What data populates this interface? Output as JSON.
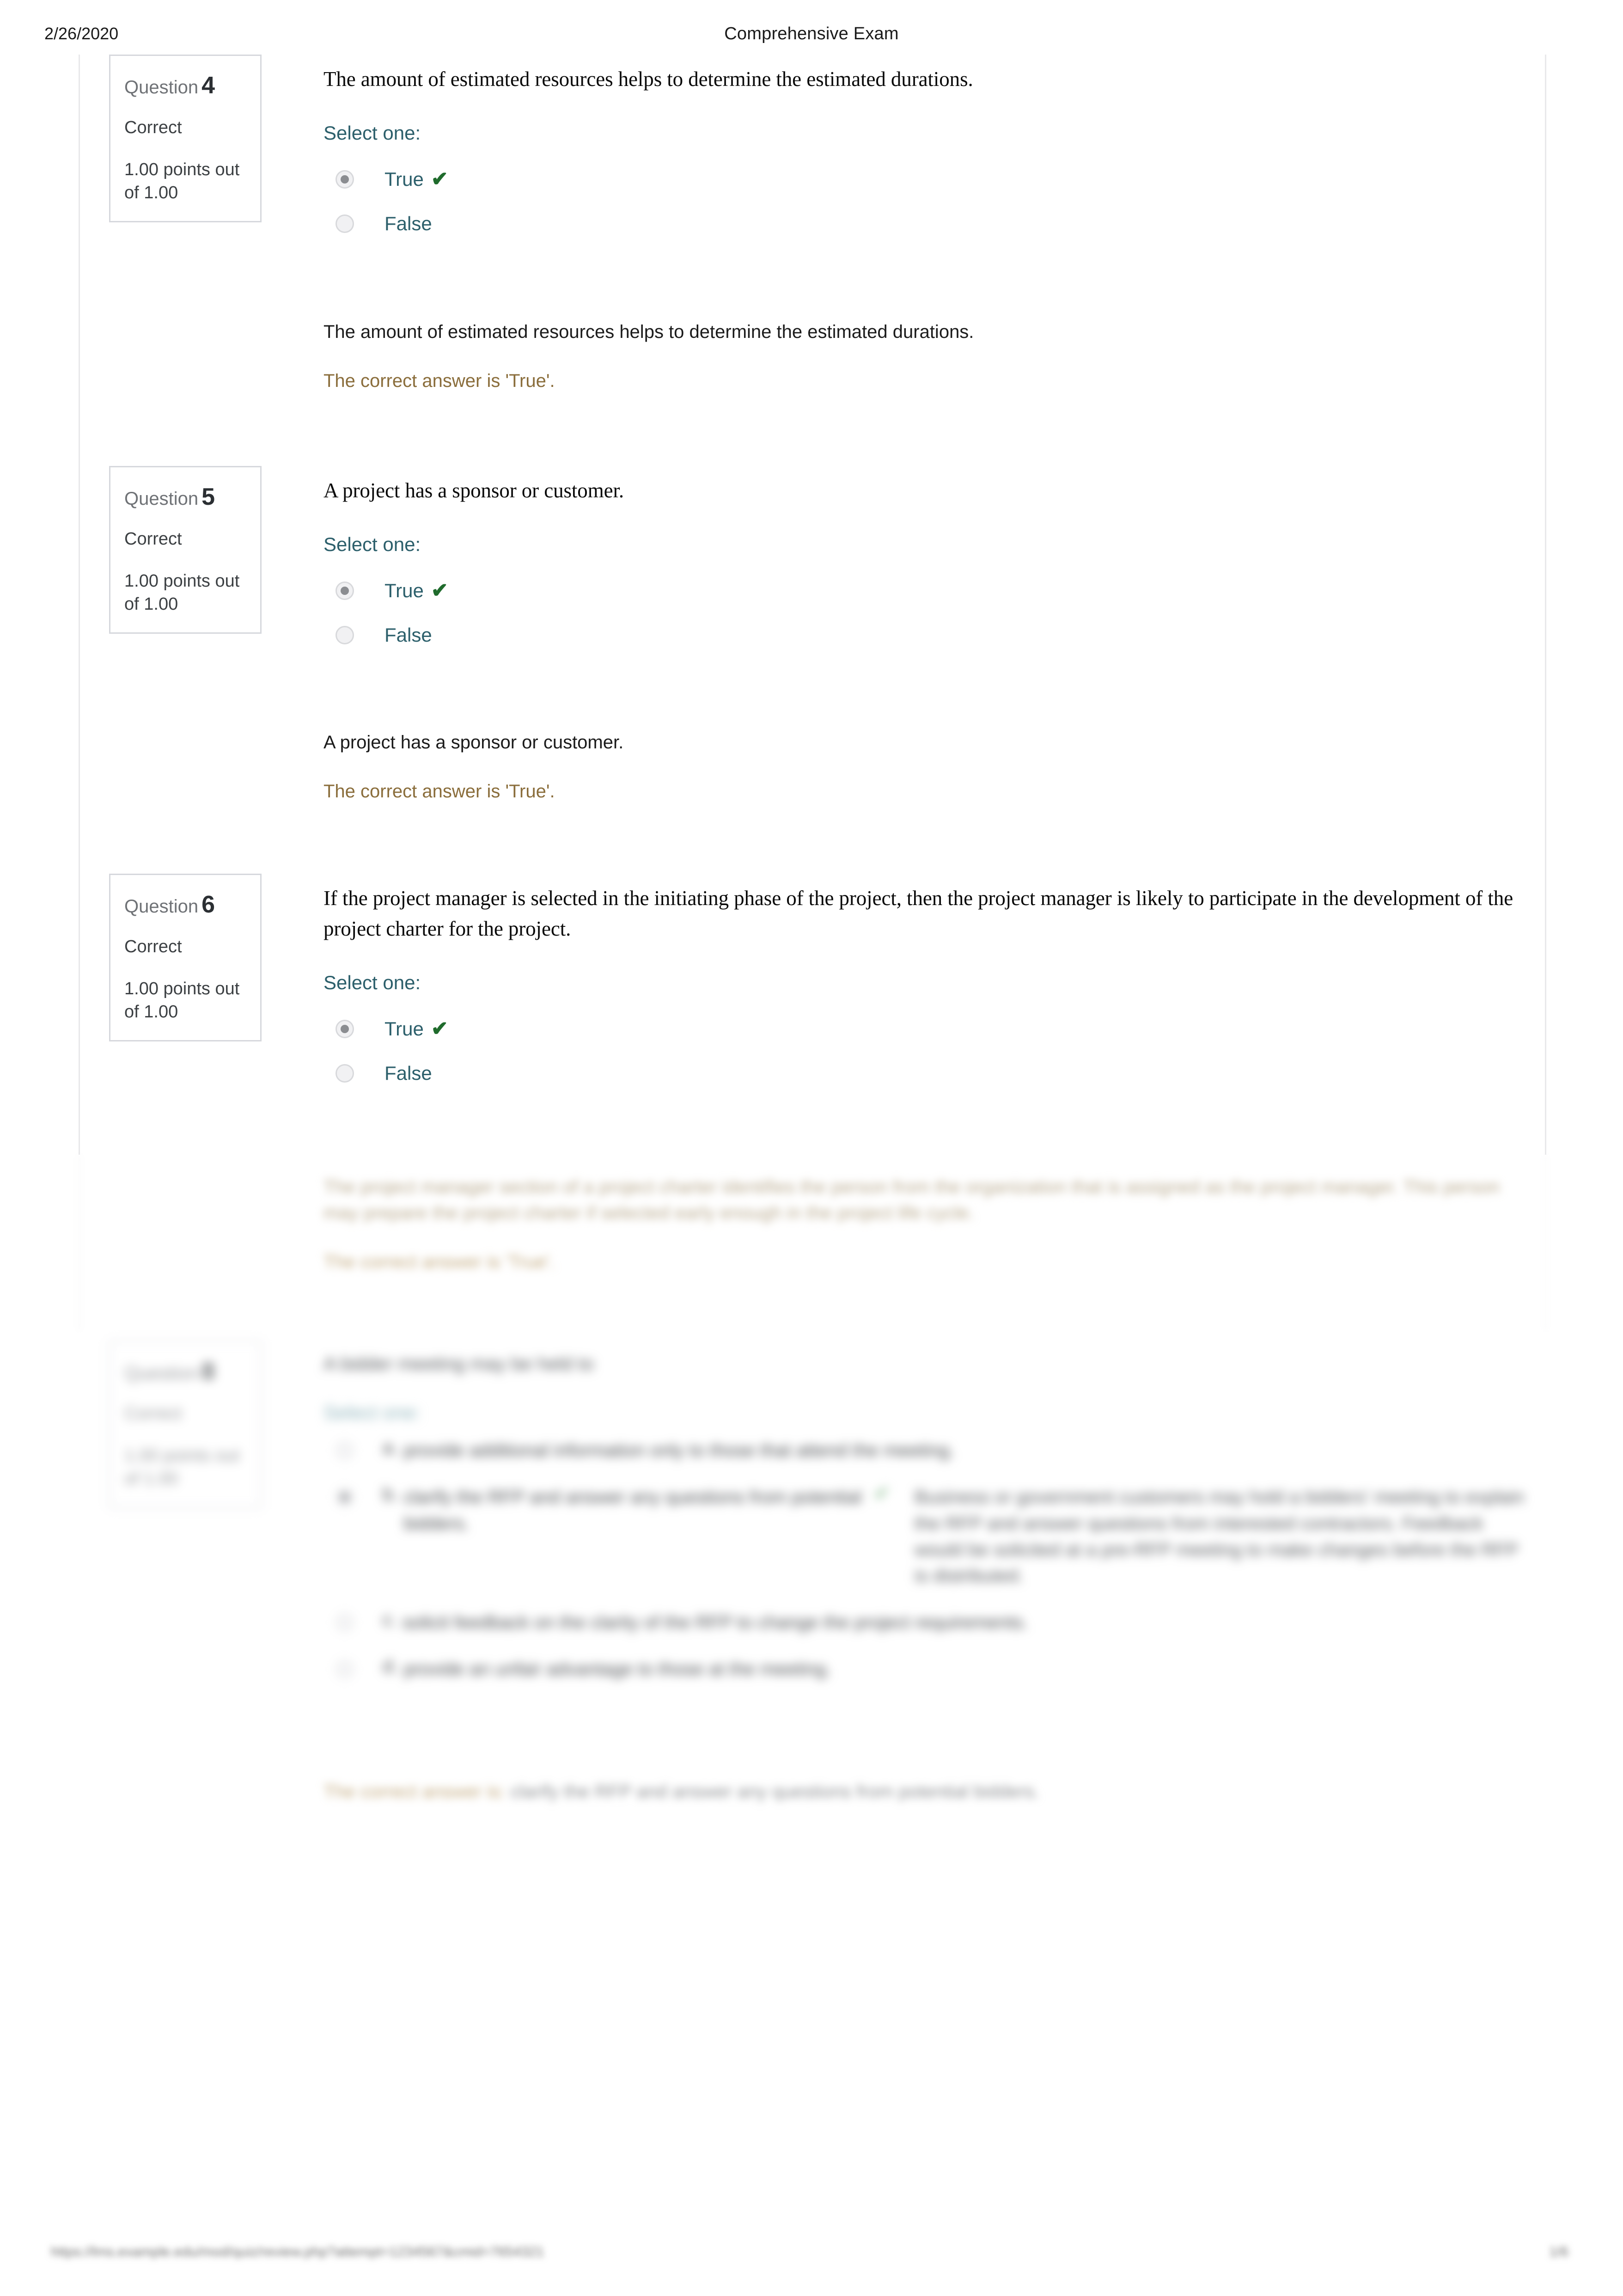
{
  "print_header": {
    "date": "2/26/2020",
    "title": "Comprehensive Exam"
  },
  "print_footer": {
    "url": "https://lms.example.edu/mod/quiz/review.php?attempt=1234567&cmid=7654321",
    "page": "1/6"
  },
  "labels": {
    "select_one": "Select one:",
    "correct_tick": "✔"
  },
  "questions": [
    {
      "number_label": "Question",
      "number": "4",
      "state": "Correct",
      "grade": "1.00 points out of 1.00",
      "text": "The amount of estimated resources helps to determine the estimated durations.",
      "options": [
        {
          "label": "True",
          "selected": true,
          "correct": true
        },
        {
          "label": "False",
          "selected": false,
          "correct": false
        }
      ],
      "feedback_question": "The amount of estimated resources helps to determine the estimated durations.",
      "feedback_answer": "The correct answer is 'True'."
    },
    {
      "number_label": "Question",
      "number": "5",
      "state": "Correct",
      "grade": "1.00 points out of 1.00",
      "text": "A project has a sponsor or customer.",
      "options": [
        {
          "label": "True",
          "selected": true,
          "correct": true
        },
        {
          "label": "False",
          "selected": false,
          "correct": false
        }
      ],
      "feedback_question": "A project has a sponsor or customer.",
      "feedback_answer": "The correct answer is 'True'."
    },
    {
      "number_label": "Question",
      "number": "6",
      "state": "Correct",
      "grade": "1.00 points out of 1.00",
      "text": "If the project manager is selected in the initiating phase of the project, then the project manager is likely to participate in the development of the project charter for the project.",
      "options": [
        {
          "label": "True",
          "selected": true,
          "correct": true
        },
        {
          "label": "False",
          "selected": false,
          "correct": false
        }
      ],
      "feedback_question": "The project manager section of a project charter identifies the person from the organization that is assigned as the project manager. This person may prepare the project charter if selected early enough in the project life cycle.",
      "feedback_answer": "The correct answer is 'True'."
    }
  ],
  "blurred_question": {
    "number_label": "Question",
    "number": "8",
    "state": "Correct",
    "grade": "1.00 points out of 1.00",
    "text": "A bidder meeting may be held to",
    "options": [
      {
        "letter": "a.",
        "text": "provide additional information only to those that attend the meeting.",
        "selected": false,
        "correct": false,
        "extra": ""
      },
      {
        "letter": "b.",
        "text": "clarify the RFP and answer any questions from potential bidders.",
        "selected": true,
        "correct": true,
        "extra": "Business or government customers may hold a bidders' meeting to explain the RFP and answer questions from interested contractors. Feedback would be solicited at a pre-RFP meeting to make changes before the RFP is distributed."
      },
      {
        "letter": "c.",
        "text": "solicit feedback on the clarity of the RFP to change the project requirements.",
        "selected": false,
        "correct": false,
        "extra": ""
      },
      {
        "letter": "d.",
        "text": "provide an unfair advantage to those at the meeting.",
        "selected": false,
        "correct": false,
        "extra": ""
      }
    ],
    "feedback_answer_prefix": "The correct answer is:",
    "feedback_answer_body": "clarify the RFP and answer any questions from potential bidders."
  }
}
